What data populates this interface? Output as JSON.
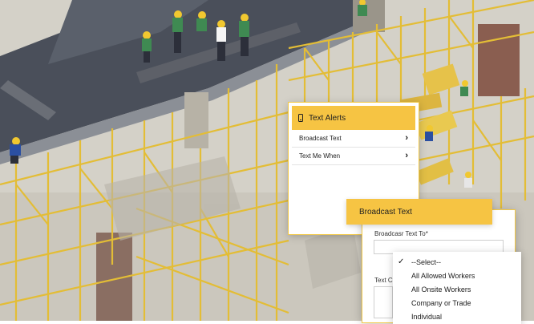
{
  "alerts_panel": {
    "title": "Text Alerts",
    "items": [
      {
        "label": "Broadcast Text"
      },
      {
        "label": "Text Me When"
      }
    ]
  },
  "broadcast_panel": {
    "title": "Broadcast Text",
    "to_label": "Broadcasr Text To*",
    "text_label": "Text C",
    "options": [
      "--Select--",
      "All Allowed Workers",
      "All Onsite Workers",
      "Company or Trade",
      "Individual"
    ],
    "selected_option": "--Select--"
  },
  "icons": {
    "alerts": "phone-icon",
    "chevron": "chevron-right-icon",
    "check": "check-icon"
  },
  "colors": {
    "accent_yellow": "#f6c443",
    "scaffold_yellow": "#e8c23a"
  }
}
